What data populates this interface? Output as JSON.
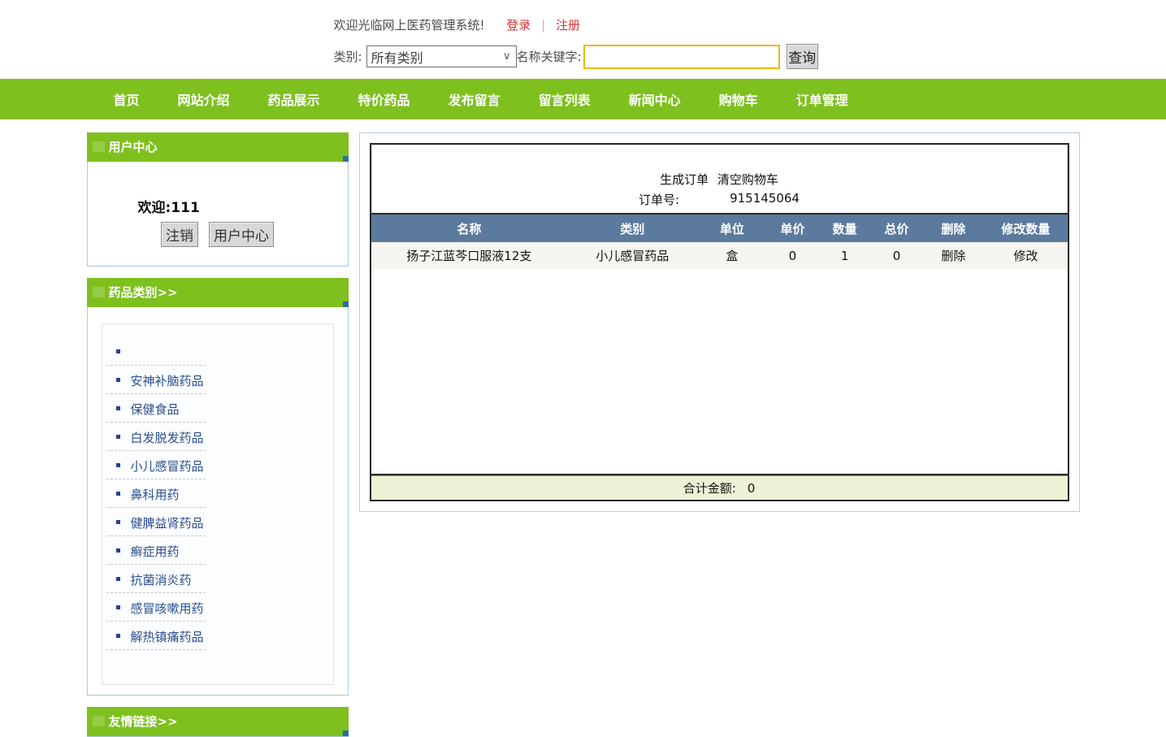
{
  "topbar": {
    "welcome": "欢迎光临网上医药管理系统!",
    "login": "登录",
    "separator": "|",
    "register": "注册",
    "category_label": "类别:",
    "category_value": "所有类别",
    "keyword_label": "名称关键字:",
    "keyword_value": "",
    "search_button": "查询"
  },
  "icons": {
    "chevron_down": "∨"
  },
  "nav": {
    "items": [
      "首页",
      "网站介绍",
      "药品展示",
      "特价药品",
      "发布留言",
      "留言列表",
      "新闻中心",
      "购物车",
      "订单管理"
    ]
  },
  "sidebar": {
    "user_center": {
      "title": "用户中心",
      "welcome_text": "欢迎:111",
      "logout_button": "注销",
      "center_button": "用户中心"
    },
    "categories": {
      "title": "药品类别>>",
      "items": [
        "",
        "安神补脑药品",
        "保健食品",
        "白发脱发药品",
        "小儿感冒药品",
        "鼻科用药",
        "健脾益肾药品",
        "癣症用药",
        "抗菌消炎药",
        "感冒咳嗽用药",
        "解热镇痛药品"
      ]
    },
    "links": {
      "title": "友情链接>>"
    }
  },
  "cart": {
    "generate_order": "生成订单",
    "clear_cart": "清空购物车",
    "order_no_label": "订单号:",
    "order_no": "915145064",
    "columns": [
      "名称",
      "类别",
      "单位",
      "单价",
      "数量",
      "总价",
      "删除",
      "修改数量"
    ],
    "rows": [
      {
        "name": "扬子江蓝芩口服液12支",
        "category": "小儿感冒药品",
        "unit": "盒",
        "price": "0",
        "qty": "1",
        "total": "0",
        "delete": "删除",
        "modify": "修改"
      }
    ],
    "total_label": "合计金额:",
    "total_value": "0"
  },
  "colors": {
    "green": "#7ec01e",
    "table_header_blue": "#5b7a9d",
    "footer_yellow": "#eff2d6",
    "category_link_blue": "#2b4e8f",
    "red_link": "#d63434",
    "input_gold_border": "#ecb90c"
  }
}
